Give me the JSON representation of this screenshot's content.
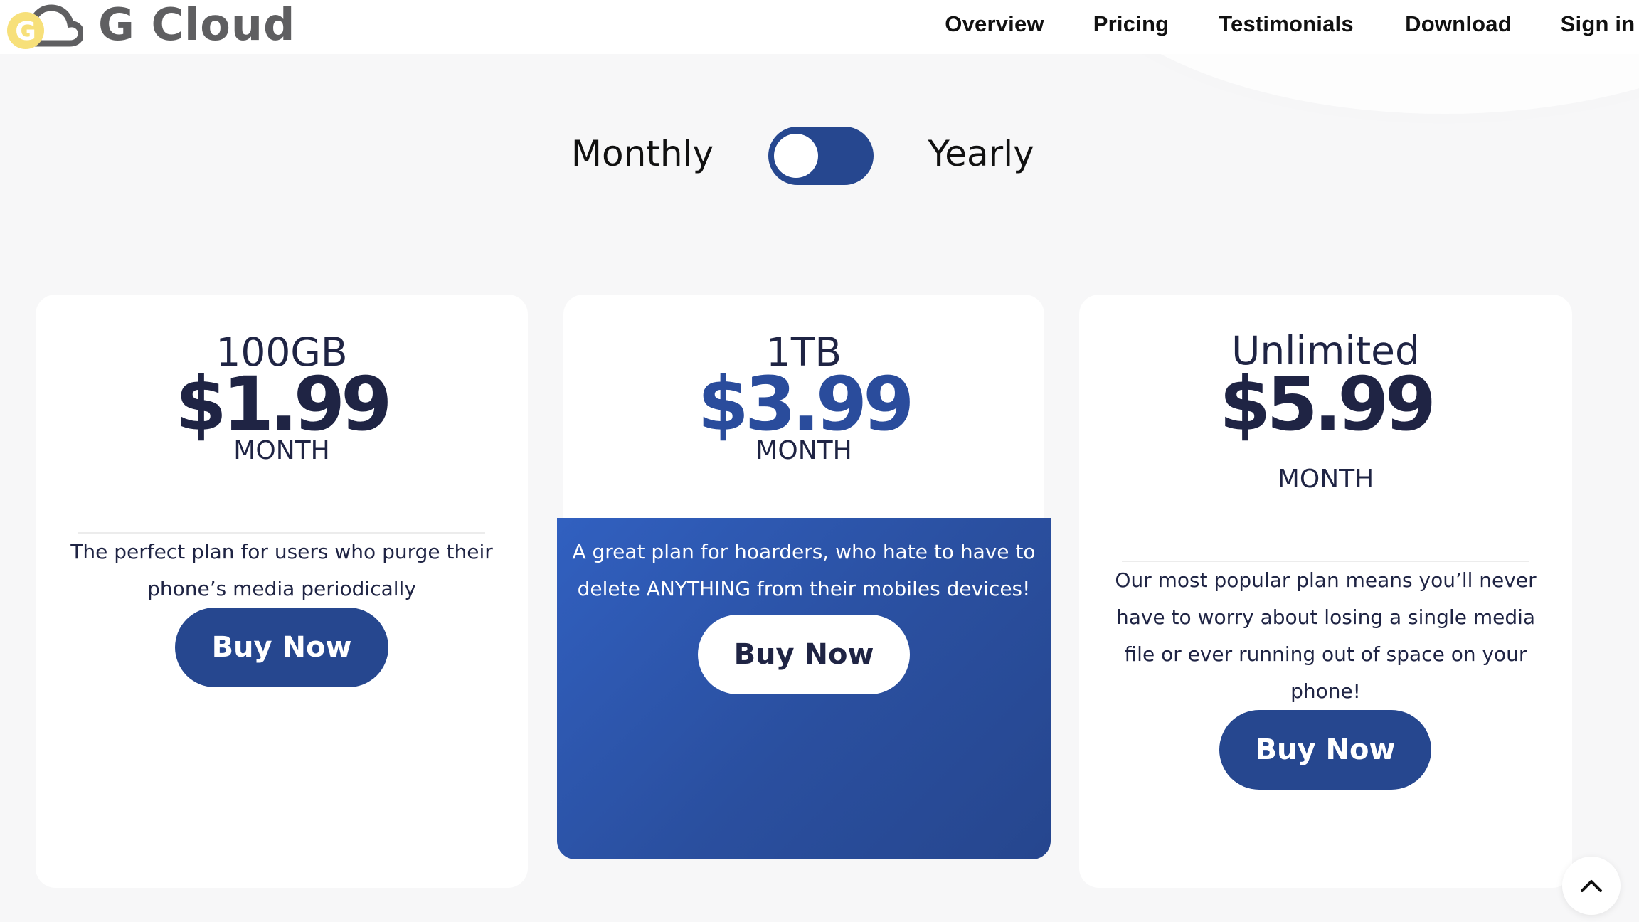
{
  "header": {
    "logo_letter": "G",
    "brand": "G Cloud",
    "nav": [
      {
        "label": "Overview"
      },
      {
        "label": "Pricing"
      },
      {
        "label": "Testimonials"
      },
      {
        "label": "Download"
      },
      {
        "label": "Sign in"
      }
    ]
  },
  "billing_toggle": {
    "left_label": "Monthly",
    "right_label": "Yearly",
    "selected": "Monthly"
  },
  "plans": [
    {
      "name": "100GB",
      "price": "$1.99",
      "period": "MONTH",
      "description_lines": [
        "The perfect plan for users who purge their",
        "phone’s media periodically"
      ],
      "button": "Buy Now",
      "highlighted": false
    },
    {
      "name": "1TB",
      "price": "$3.99",
      "period": "MONTH",
      "description_lines": [
        "A great plan for hoarders, who hate to have to",
        "delete ANYTHING from their mobiles devices!"
      ],
      "button": "Buy Now",
      "highlighted": true
    },
    {
      "name": "Unlimited",
      "price": "$5.99",
      "period": "MONTH",
      "description_lines": [
        "Our most popular plan means you’ll never",
        "have to worry about losing a single media",
        "file or ever running out of space on your",
        "phone!"
      ],
      "button": "Buy Now",
      "highlighted": false
    }
  ],
  "colors": {
    "primary": "#26478f",
    "price_highlight": "#2a4c9c",
    "text_dark": "#1f2444",
    "logo_yellow": "#f7e07a",
    "logo_gray": "#5f5f61",
    "background": "#f7f7f8"
  },
  "scroll_top": {
    "icon": "chevron-up-icon"
  }
}
